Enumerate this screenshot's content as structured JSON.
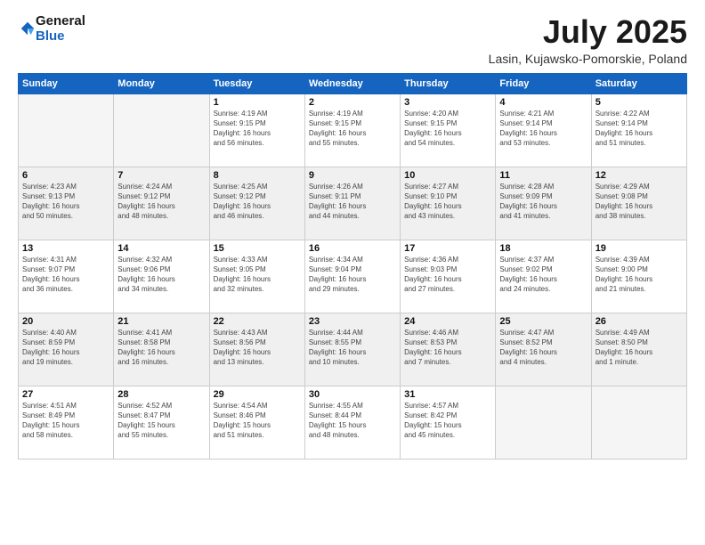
{
  "logo": {
    "general": "General",
    "blue": "Blue"
  },
  "title": "July 2025",
  "location": "Lasin, Kujawsko-Pomorskie, Poland",
  "headers": [
    "Sunday",
    "Monday",
    "Tuesday",
    "Wednesday",
    "Thursday",
    "Friday",
    "Saturday"
  ],
  "weeks": [
    [
      {
        "day": "",
        "detail": ""
      },
      {
        "day": "",
        "detail": ""
      },
      {
        "day": "1",
        "detail": "Sunrise: 4:19 AM\nSunset: 9:15 PM\nDaylight: 16 hours\nand 56 minutes."
      },
      {
        "day": "2",
        "detail": "Sunrise: 4:19 AM\nSunset: 9:15 PM\nDaylight: 16 hours\nand 55 minutes."
      },
      {
        "day": "3",
        "detail": "Sunrise: 4:20 AM\nSunset: 9:15 PM\nDaylight: 16 hours\nand 54 minutes."
      },
      {
        "day": "4",
        "detail": "Sunrise: 4:21 AM\nSunset: 9:14 PM\nDaylight: 16 hours\nand 53 minutes."
      },
      {
        "day": "5",
        "detail": "Sunrise: 4:22 AM\nSunset: 9:14 PM\nDaylight: 16 hours\nand 51 minutes."
      }
    ],
    [
      {
        "day": "6",
        "detail": "Sunrise: 4:23 AM\nSunset: 9:13 PM\nDaylight: 16 hours\nand 50 minutes."
      },
      {
        "day": "7",
        "detail": "Sunrise: 4:24 AM\nSunset: 9:12 PM\nDaylight: 16 hours\nand 48 minutes."
      },
      {
        "day": "8",
        "detail": "Sunrise: 4:25 AM\nSunset: 9:12 PM\nDaylight: 16 hours\nand 46 minutes."
      },
      {
        "day": "9",
        "detail": "Sunrise: 4:26 AM\nSunset: 9:11 PM\nDaylight: 16 hours\nand 44 minutes."
      },
      {
        "day": "10",
        "detail": "Sunrise: 4:27 AM\nSunset: 9:10 PM\nDaylight: 16 hours\nand 43 minutes."
      },
      {
        "day": "11",
        "detail": "Sunrise: 4:28 AM\nSunset: 9:09 PM\nDaylight: 16 hours\nand 41 minutes."
      },
      {
        "day": "12",
        "detail": "Sunrise: 4:29 AM\nSunset: 9:08 PM\nDaylight: 16 hours\nand 38 minutes."
      }
    ],
    [
      {
        "day": "13",
        "detail": "Sunrise: 4:31 AM\nSunset: 9:07 PM\nDaylight: 16 hours\nand 36 minutes."
      },
      {
        "day": "14",
        "detail": "Sunrise: 4:32 AM\nSunset: 9:06 PM\nDaylight: 16 hours\nand 34 minutes."
      },
      {
        "day": "15",
        "detail": "Sunrise: 4:33 AM\nSunset: 9:05 PM\nDaylight: 16 hours\nand 32 minutes."
      },
      {
        "day": "16",
        "detail": "Sunrise: 4:34 AM\nSunset: 9:04 PM\nDaylight: 16 hours\nand 29 minutes."
      },
      {
        "day": "17",
        "detail": "Sunrise: 4:36 AM\nSunset: 9:03 PM\nDaylight: 16 hours\nand 27 minutes."
      },
      {
        "day": "18",
        "detail": "Sunrise: 4:37 AM\nSunset: 9:02 PM\nDaylight: 16 hours\nand 24 minutes."
      },
      {
        "day": "19",
        "detail": "Sunrise: 4:39 AM\nSunset: 9:00 PM\nDaylight: 16 hours\nand 21 minutes."
      }
    ],
    [
      {
        "day": "20",
        "detail": "Sunrise: 4:40 AM\nSunset: 8:59 PM\nDaylight: 16 hours\nand 19 minutes."
      },
      {
        "day": "21",
        "detail": "Sunrise: 4:41 AM\nSunset: 8:58 PM\nDaylight: 16 hours\nand 16 minutes."
      },
      {
        "day": "22",
        "detail": "Sunrise: 4:43 AM\nSunset: 8:56 PM\nDaylight: 16 hours\nand 13 minutes."
      },
      {
        "day": "23",
        "detail": "Sunrise: 4:44 AM\nSunset: 8:55 PM\nDaylight: 16 hours\nand 10 minutes."
      },
      {
        "day": "24",
        "detail": "Sunrise: 4:46 AM\nSunset: 8:53 PM\nDaylight: 16 hours\nand 7 minutes."
      },
      {
        "day": "25",
        "detail": "Sunrise: 4:47 AM\nSunset: 8:52 PM\nDaylight: 16 hours\nand 4 minutes."
      },
      {
        "day": "26",
        "detail": "Sunrise: 4:49 AM\nSunset: 8:50 PM\nDaylight: 16 hours\nand 1 minute."
      }
    ],
    [
      {
        "day": "27",
        "detail": "Sunrise: 4:51 AM\nSunset: 8:49 PM\nDaylight: 15 hours\nand 58 minutes."
      },
      {
        "day": "28",
        "detail": "Sunrise: 4:52 AM\nSunset: 8:47 PM\nDaylight: 15 hours\nand 55 minutes."
      },
      {
        "day": "29",
        "detail": "Sunrise: 4:54 AM\nSunset: 8:46 PM\nDaylight: 15 hours\nand 51 minutes."
      },
      {
        "day": "30",
        "detail": "Sunrise: 4:55 AM\nSunset: 8:44 PM\nDaylight: 15 hours\nand 48 minutes."
      },
      {
        "day": "31",
        "detail": "Sunrise: 4:57 AM\nSunset: 8:42 PM\nDaylight: 15 hours\nand 45 minutes."
      },
      {
        "day": "",
        "detail": ""
      },
      {
        "day": "",
        "detail": ""
      }
    ]
  ]
}
